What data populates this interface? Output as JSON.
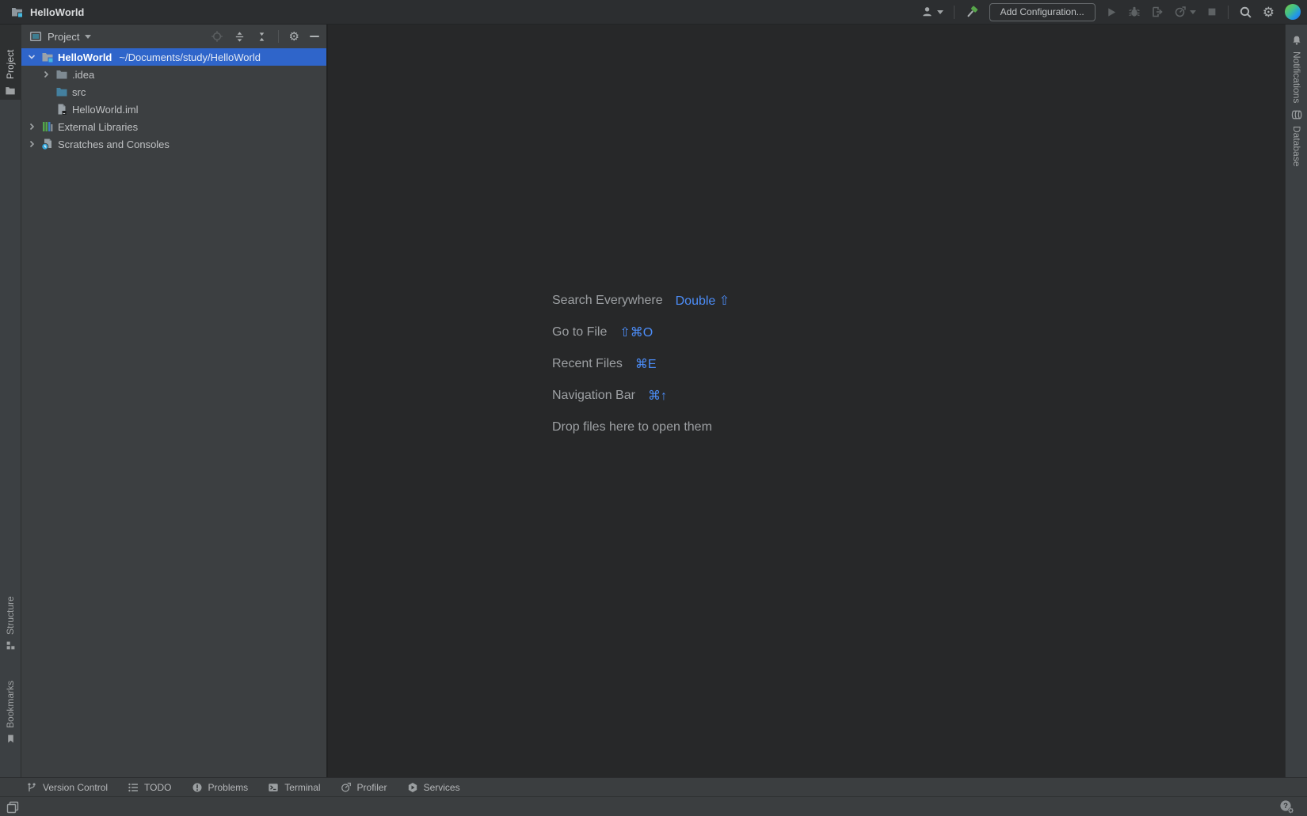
{
  "title_bar": {
    "title": "HelloWorld"
  },
  "top_toolbar": {
    "add_configuration_label": "Add Configuration..."
  },
  "left_stripe": {
    "project_label": "Project",
    "structure_label": "Structure",
    "bookmarks_label": "Bookmarks"
  },
  "right_stripe": {
    "notifications_label": "Notifications",
    "database_label": "Database"
  },
  "project_panel": {
    "header_title": "Project",
    "tree": [
      {
        "label": "HelloWorld",
        "path": "~/Documents/study/HelloWorld"
      },
      {
        "label": ".idea"
      },
      {
        "label": "src"
      },
      {
        "label": "HelloWorld.iml"
      },
      {
        "label": "External Libraries"
      },
      {
        "label": "Scratches and Consoles"
      }
    ]
  },
  "editor_hints": {
    "items": [
      {
        "label": "Search Everywhere",
        "shortcut": "Double ⇧"
      },
      {
        "label": "Go to File",
        "shortcut": "⇧⌘O"
      },
      {
        "label": "Recent Files",
        "shortcut": "⌘E"
      },
      {
        "label": "Navigation Bar",
        "shortcut": "⌘↑"
      }
    ],
    "drop_hint": "Drop files here to open them"
  },
  "bottom_tool_bar": {
    "items": [
      {
        "label": "Version Control"
      },
      {
        "label": "TODO"
      },
      {
        "label": "Problems"
      },
      {
        "label": "Terminal"
      },
      {
        "label": "Profiler"
      },
      {
        "label": "Services"
      }
    ]
  },
  "colors": {
    "selection_blue": "#2F65CA",
    "shortcut_blue": "#4C8DF8",
    "panel_bg": "#3C3F41",
    "editor_bg": "#272829",
    "stripe_bg": "#3C4043",
    "titlebar_bg": "#2C2E30"
  }
}
